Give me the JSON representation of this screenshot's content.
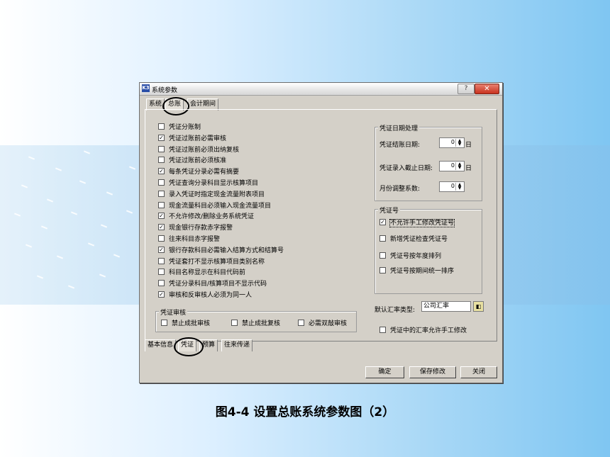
{
  "window": {
    "title": "系统参数",
    "icon_glyph": "K3",
    "help_glyph": "?",
    "close_glyph": "✕"
  },
  "top_tabs": [
    "系统",
    "总账",
    "会计期间"
  ],
  "options": [
    {
      "label": "凭证分账制",
      "checked": false
    },
    {
      "label": "凭证过账前必需审核",
      "checked": true
    },
    {
      "label": "凭证过账前必须出纳复核",
      "checked": false
    },
    {
      "label": "凭证过账前必须核准",
      "checked": false
    },
    {
      "label": "每条凭证分录必需有摘要",
      "checked": true
    },
    {
      "label": "凭证查询分录科目显示核算项目",
      "checked": false
    },
    {
      "label": "录入凭证时指定现金流量附表项目",
      "checked": false
    },
    {
      "label": "现金流量科目必须输入现金流量项目",
      "checked": false
    },
    {
      "label": "不允许修改/删除业务系统凭证",
      "checked": true
    },
    {
      "label": "现金银行存款赤字报警",
      "checked": true
    },
    {
      "label": "往来科目赤字报警",
      "checked": false
    },
    {
      "label": "银行存款科目必需输入结算方式和结算号",
      "checked": true
    },
    {
      "label": "凭证套打不显示核算项目类别名称",
      "checked": false
    },
    {
      "label": "科目名称显示在科目代码前",
      "checked": false
    },
    {
      "label": "凭证分录科目/核算项目不显示代码",
      "checked": false
    },
    {
      "label": "审核和反审核人必须为同一人",
      "checked": true
    }
  ],
  "audit_group": {
    "title": "凭证审核",
    "items": [
      {
        "label": "禁止成批审核",
        "checked": false
      },
      {
        "label": "禁止成批复核",
        "checked": false
      },
      {
        "label": "必需双敲审核",
        "checked": false
      }
    ]
  },
  "date_group": {
    "title": "凭证日期处理",
    "fields": [
      {
        "label": "凭证结账日期:",
        "value": "0",
        "unit": "日"
      },
      {
        "label": "凭证录入截止日期:",
        "value": "0",
        "unit": "日"
      },
      {
        "label": "月份调整系数:",
        "value": "0",
        "unit": ""
      }
    ]
  },
  "number_group": {
    "title": "凭证号",
    "items": [
      {
        "label": "不允许手工修改凭证号",
        "checked": true
      },
      {
        "label": "新增凭证检查凭证号",
        "checked": false
      },
      {
        "label": "凭证号按年度排列",
        "checked": false
      },
      {
        "label": "凭证号按期间统一排序",
        "checked": false
      }
    ]
  },
  "rate_type": {
    "label": "默认汇率类型:",
    "value": "公司汇率"
  },
  "allow_rate_edit": {
    "label": "凭证中的汇率允许手工修改",
    "checked": false
  },
  "bottom_tabs": [
    "基本信息",
    "凭证",
    "预算",
    "往来传递"
  ],
  "buttons": {
    "ok": "确定",
    "save": "保存修改",
    "close": "关闭"
  },
  "caption": "图4-4  设置总账系统参数图（2）",
  "colors": {
    "accent_background": "#7fc6f2",
    "dialog": "#d4d0c8",
    "close_button": "#c8321e"
  }
}
